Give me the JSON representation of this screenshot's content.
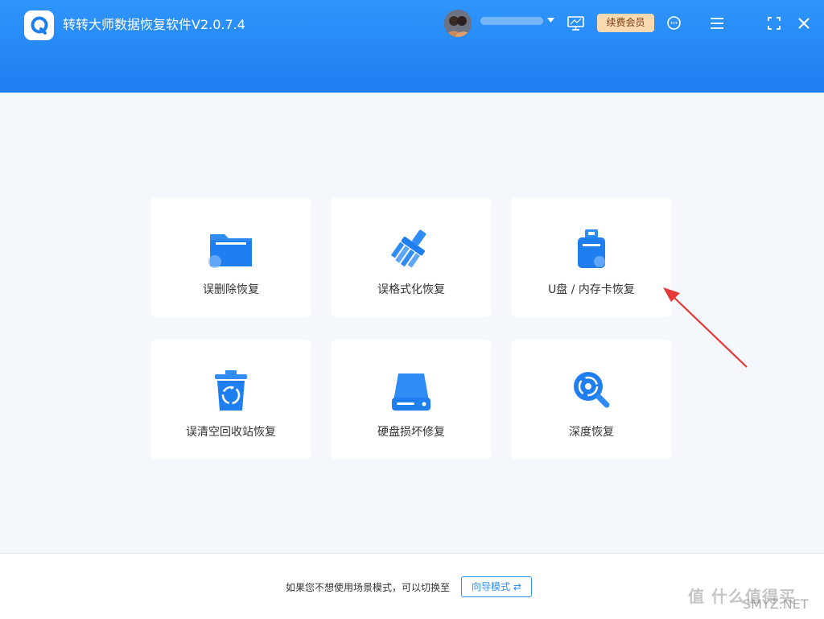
{
  "app": {
    "title": "转转大师数据恢复软件V2.0.7.4",
    "vip_label": "续费会员"
  },
  "colors": {
    "header": "#1d7ef0",
    "accent": "#2f8cf5",
    "vip_bg": "#f8d9b0",
    "arrow": "#e53935"
  },
  "header_icons": [
    "logo-icon",
    "avatar",
    "dropdown-icon",
    "monitor-icon",
    "support-icon",
    "menu-icon",
    "fullscreen-icon",
    "close-icon"
  ],
  "cards": [
    {
      "label": "误删除恢复",
      "icon": "folder-icon"
    },
    {
      "label": "误格式化恢复",
      "icon": "broom-icon"
    },
    {
      "label": "U盘 / 内存卡恢复",
      "icon": "usb-drive-icon"
    },
    {
      "label": "误清空回收站恢复",
      "icon": "recycle-bin-icon"
    },
    {
      "label": "硬盘损坏修复",
      "icon": "hard-disk-icon"
    },
    {
      "label": "深度恢复",
      "icon": "deep-scan-icon"
    }
  ],
  "footer": {
    "text": "如果您不想使用场景模式，可以切换至",
    "wizard_button": "向导模式"
  },
  "watermark": {
    "text": "值 什么值得买",
    "site": "SMYZ.NET"
  }
}
